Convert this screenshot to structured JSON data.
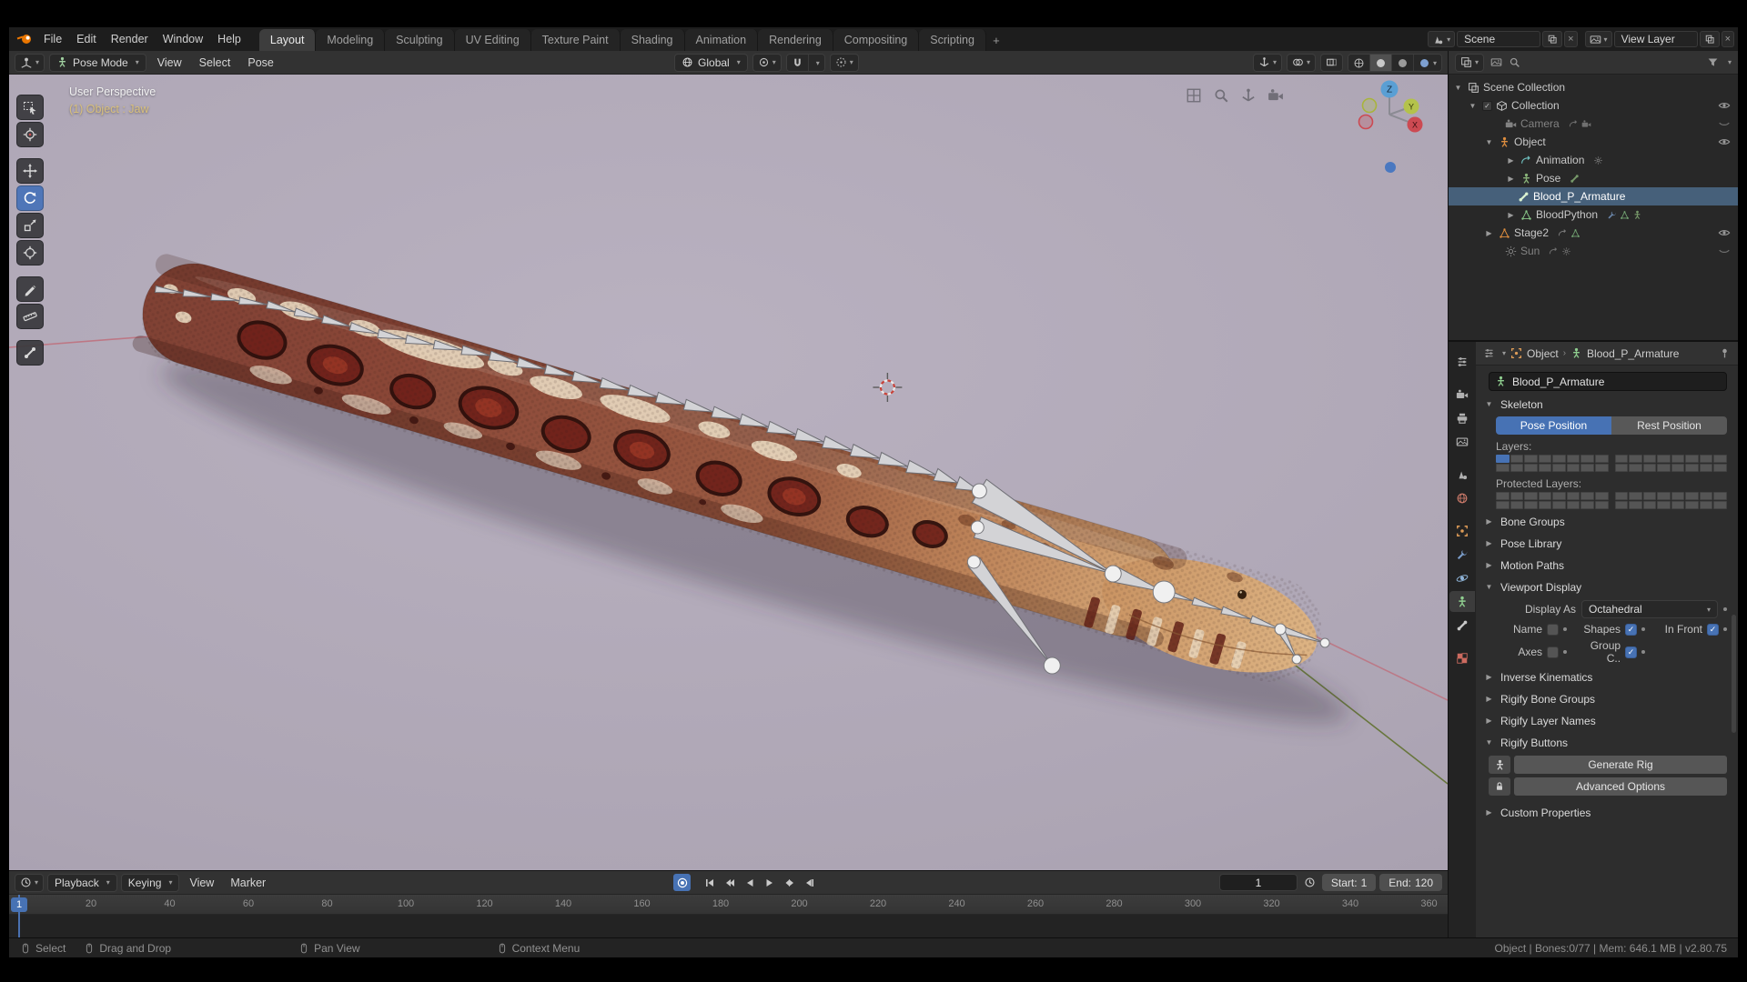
{
  "topbar": {
    "menus": [
      "File",
      "Edit",
      "Render",
      "Window",
      "Help"
    ],
    "tabs": [
      "Layout",
      "Modeling",
      "Sculpting",
      "UV Editing",
      "Texture Paint",
      "Shading",
      "Animation",
      "Rendering",
      "Compositing",
      "Scripting"
    ],
    "active_tab": "Layout",
    "add_tab": "+",
    "scene_value": "Scene",
    "view_layer_value": "View Layer"
  },
  "viewport": {
    "mode": "Pose Mode",
    "menus": [
      "View",
      "Select",
      "Pose"
    ],
    "orientation": "Global",
    "overlay_line1": "User Perspective",
    "overlay_line2": "(1) Object : Jaw",
    "axis_x": "X",
    "axis_y": "Y",
    "axis_z": "Z"
  },
  "outliner": {
    "items": [
      {
        "label": "Scene Collection"
      },
      {
        "label": "Collection"
      },
      {
        "label": "Camera"
      },
      {
        "label": "Object"
      },
      {
        "label": "Animation"
      },
      {
        "label": "Pose"
      },
      {
        "label": "Blood_P_Armature"
      },
      {
        "label": "BloodPython"
      },
      {
        "label": "Stage2"
      },
      {
        "label": "Sun"
      }
    ],
    "selected": "Blood_P_Armature"
  },
  "properties": {
    "breadcrumb_object": "Object",
    "breadcrumb_data": "Blood_P_Armature",
    "name_value": "Blood_P_Armature",
    "skeleton": {
      "title": "Skeleton",
      "pose_position": "Pose Position",
      "rest_position": "Rest Position",
      "active_position": "Pose Position",
      "layers_label": "Layers:",
      "protected_label": "Protected Layers:"
    },
    "collapsed_1": [
      "Bone Groups",
      "Pose Library",
      "Motion Paths"
    ],
    "viewport_display": {
      "title": "Viewport Display",
      "display_as_label": "Display As",
      "display_as_value": "Octahedral",
      "cb_name": "Name",
      "cb_shapes": "Shapes",
      "cb_in_front": "In Front",
      "cb_axes": "Axes",
      "cb_group": "Group C..",
      "states": {
        "name": false,
        "shapes": true,
        "in_front": true,
        "axes": false,
        "group": true
      }
    },
    "collapsed_2": [
      "Inverse Kinematics",
      "Rigify Bone Groups",
      "Rigify Layer Names"
    ],
    "rigify_buttons": {
      "title": "Rigify Buttons",
      "generate": "Generate Rig",
      "advanced": "Advanced Options"
    },
    "custom_properties": "Custom Properties"
  },
  "timeline": {
    "menus": [
      "Playback",
      "Keying",
      "View",
      "Marker"
    ],
    "frame_value": "1",
    "start_label": "Start:",
    "start_value": "1",
    "end_label": "End:",
    "end_value": "120",
    "playhead": "1",
    "ticks": [
      "20",
      "40",
      "60",
      "80",
      "100",
      "120",
      "140",
      "160",
      "180",
      "200",
      "220",
      "240",
      "260",
      "280",
      "300",
      "320",
      "340",
      "360"
    ]
  },
  "statusbar": {
    "hint_select": "Select",
    "hint_drag": "Drag and Drop",
    "hint_pan": "Pan View",
    "hint_context": "Context Menu",
    "stats": "Object | Bones:0/77 | Mem: 646.1 MB | v2.80.75"
  }
}
